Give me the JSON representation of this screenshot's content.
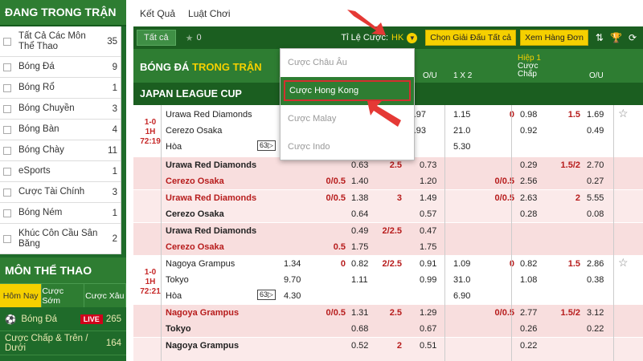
{
  "sidebar": {
    "title": "ĐANG TRONG TRẬN",
    "items": [
      {
        "label": "Tất Cả Các Môn Thể Thao",
        "count": "35"
      },
      {
        "label": "Bóng Đá",
        "count": "9"
      },
      {
        "label": "Bóng Rổ",
        "count": "1"
      },
      {
        "label": "Bóng Chuyền",
        "count": "3"
      },
      {
        "label": "Bóng Bàn",
        "count": "4"
      },
      {
        "label": "Bóng Chày",
        "count": "11"
      },
      {
        "label": "eSports",
        "count": "1"
      },
      {
        "label": "Cược Tài Chính",
        "count": "3"
      },
      {
        "label": "Bóng Ném",
        "count": "1"
      },
      {
        "label": "Khúc Côn Cầu Sân Băng",
        "count": "2"
      }
    ],
    "sports_title": "MÔN THỂ THAO",
    "tabs": [
      "Hôm Nay",
      "Cược Sớm",
      "Cược Xâu"
    ],
    "sport_rows": [
      {
        "label": "Bóng Đá",
        "badge": "LIVE",
        "count": "265"
      },
      {
        "label": "Cược Chấp & Trên / Dưới",
        "count": "164"
      }
    ]
  },
  "topnav": {
    "results": "Kết Quả",
    "rules": "Luật Chơi"
  },
  "toolbar": {
    "all_label": "Tất cả",
    "fav_count": "0",
    "odds_label": "Tỉ Lệ Cược:",
    "odds_value": "HK",
    "choose_league": "Chọn Giải Đấu",
    "choose_league_value": "Tất cả",
    "view_orders": "Xem Hàng Đơn"
  },
  "header": {
    "title_a": "BÓNG ĐÁ",
    "title_b": "TRONG TRẬN",
    "col_ou": "O/U",
    "col_1x2": "1 X 2",
    "half_label": "Hiệp 1",
    "col_hdp": "Cược Chấp",
    "col_ou2": "O/U"
  },
  "league": "JAPAN LEAGUE CUP",
  "dropdown": {
    "items": [
      "Cược Châu Âu",
      "Cược Hong Kong",
      "Cược Malay",
      "Cược Indo"
    ],
    "selected": "Cược Hong Kong"
  },
  "match1": {
    "score": "1-0",
    "half": "1H",
    "time": "72:19",
    "home": "Urawa Red Diamonds",
    "away": "Cerezo Osaka",
    "draw": "Hòa",
    "tv": "63",
    "r1": [
      "0.97",
      "1.15",
      "0",
      "0.98",
      "1.5",
      "1.69"
    ],
    "r2": [
      "0.93",
      "21.0",
      "0.92",
      "0.49"
    ],
    "r3": [
      "5.30"
    ]
  },
  "match1_sub": [
    {
      "home": "Urawa Red Diamonds",
      "away": "Cerezo Osaka",
      "h1": [
        "0.63",
        "2.5",
        "0.73",
        "0.29",
        "1.5/2",
        "2.70"
      ],
      "h2": [
        "0/0.5",
        "1.40",
        "1.20",
        "0/0.5",
        "2.56",
        "0.27"
      ]
    },
    {
      "home": "Urawa Red Diamonds",
      "away": "Cerezo Osaka",
      "h1": [
        "0/0.5",
        "1.38",
        "3",
        "1.49",
        "0/0.5",
        "2.63",
        "2",
        "5.55"
      ],
      "h2": [
        "0.64",
        "0.57",
        "0.28",
        "0.08"
      ]
    },
    {
      "home": "Urawa Red Diamonds",
      "away": "Cerezo Osaka",
      "h1": [
        "0.49",
        "2/2.5",
        "0.47"
      ],
      "h2": [
        "0.5",
        "1.75",
        "1.75"
      ]
    }
  ],
  "match2": {
    "score": "1-0",
    "half": "1H",
    "time": "72:21",
    "home": "Nagoya Grampus",
    "away": "Tokyo",
    "draw": "Hòa",
    "tv": "63",
    "r1": [
      "1.34",
      "0",
      "0.82",
      "2/2.5",
      "0.91",
      "1.09",
      "0",
      "0.82",
      "1.5",
      "2.86"
    ],
    "r2": [
      "9.70",
      "1.11",
      "0.99",
      "31.0",
      "1.08",
      "0.38"
    ],
    "r3": [
      "4.30",
      "6.90"
    ]
  },
  "match2_sub": [
    {
      "home": "Nagoya Grampus",
      "away": "Tokyo",
      "h1": [
        "0/0.5",
        "1.31",
        "2.5",
        "1.29",
        "0/0.5",
        "2.77",
        "1.5/2",
        "3.12"
      ],
      "h2": [
        "0.68",
        "0.67",
        "0.26",
        "0.22"
      ]
    },
    {
      "home": "Nagoya Grampus",
      "h1": [
        "0.52",
        "2",
        "0.51",
        "0.22"
      ]
    }
  ],
  "colors": {
    "green": "#2e7d32",
    "dark_green": "#1b5e20",
    "yellow": "#f5d000",
    "red": "#d32f2f",
    "pink": "#f8dede"
  }
}
